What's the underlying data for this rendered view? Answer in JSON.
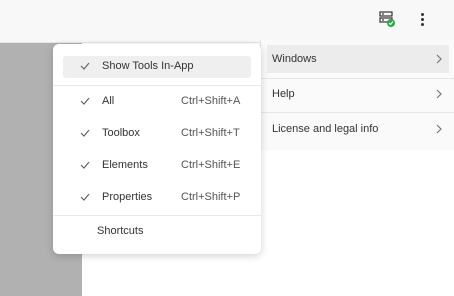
{
  "toolbar": {
    "status_icon": "server-check-icon",
    "more_icon": "more-vertical-icon"
  },
  "main_menu": {
    "items": [
      {
        "label": "Windows"
      },
      {
        "label": "Help"
      },
      {
        "label": "License and legal info"
      }
    ]
  },
  "submenu": {
    "items": [
      {
        "label": "Show Tools In-App",
        "shortcut": "",
        "checked": true
      },
      {
        "label": "All",
        "shortcut": "Ctrl+Shift+A",
        "checked": true
      },
      {
        "label": "Toolbox",
        "shortcut": "Ctrl+Shift+T",
        "checked": true
      },
      {
        "label": "Elements",
        "shortcut": "Ctrl+Shift+E",
        "checked": true
      },
      {
        "label": "Properties",
        "shortcut": "Ctrl+Shift+P",
        "checked": true
      }
    ],
    "shortcuts_label": "Shortcuts"
  },
  "colors": {
    "accent_green": "#27a844",
    "panel_gray": "#b1b1b1",
    "highlight": "#ececec"
  }
}
